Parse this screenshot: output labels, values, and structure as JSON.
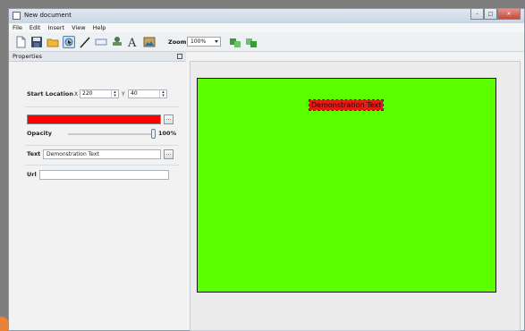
{
  "window": {
    "title": "New document"
  },
  "menu": [
    "File",
    "Edit",
    "Insert",
    "View",
    "Help"
  ],
  "toolbar": {
    "icons": [
      "new-document-icon",
      "save-icon",
      "open-folder-icon",
      "select-tool-icon",
      "line-tool-icon",
      "rectangle-tool-icon",
      "stamp-tool-icon",
      "text-tool-icon",
      "image-tool-icon"
    ],
    "zoom_label": "Zoom",
    "zoom_value": "100%"
  },
  "properties": {
    "header": "Properties",
    "start_location_label": "Start Location",
    "x_label": "X",
    "x_value": "220",
    "y_label": "Y",
    "y_value": "40",
    "color": "#ff0000",
    "opacity_label": "Opacity",
    "opacity_value": "100%",
    "opacity_fraction": 1.0,
    "text_label": "Text",
    "text_value": "Demonstration Text",
    "url_label": "Url",
    "url_value": ""
  },
  "canvas": {
    "background": "#5cff00",
    "element_text": "Demonstration Text",
    "element_fill": "#e41b17"
  }
}
